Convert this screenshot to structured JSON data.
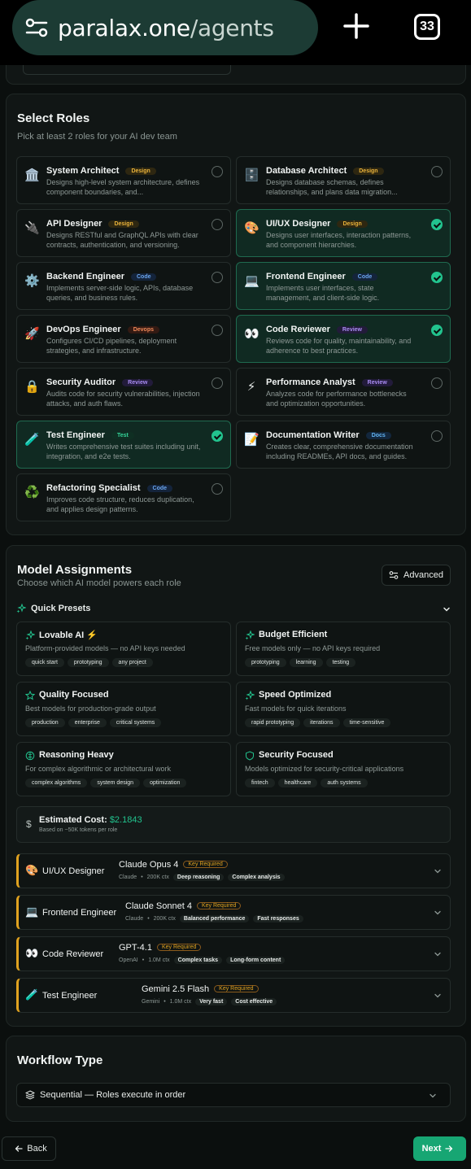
{
  "browser": {
    "url_domain": "paralax.one",
    "url_path": "/agents",
    "tab_count": "33"
  },
  "roles_section": {
    "title": "Select Roles",
    "subtitle": "Pick at least 2 roles for your AI dev team",
    "roles": [
      {
        "emoji": "🏛️",
        "name": "System Architect",
        "tag": "Design",
        "desc": "Designs high-level system architecture, defines component boundaries, and...",
        "selected": false
      },
      {
        "emoji": "🗄️",
        "name": "Database Architect",
        "tag": "Design",
        "desc": "Designs database schemas, defines relationships, and plans data migration...",
        "selected": false
      },
      {
        "emoji": "🔌",
        "name": "API Designer",
        "tag": "Design",
        "desc": "Designs RESTful and GraphQL APIs with clear contracts, authentication, and versioning.",
        "selected": false
      },
      {
        "emoji": "🎨",
        "name": "UI/UX Designer",
        "tag": "Design",
        "desc": "Designs user interfaces, interaction patterns, and component hierarchies.",
        "selected": true
      },
      {
        "emoji": "⚙️",
        "name": "Backend Engineer",
        "tag": "Code",
        "desc": "Implements server-side logic, APIs, database queries, and business rules.",
        "selected": false
      },
      {
        "emoji": "💻",
        "name": "Frontend Engineer",
        "tag": "Code",
        "desc": "Implements user interfaces, state management, and client-side logic.",
        "selected": true
      },
      {
        "emoji": "🚀",
        "name": "DevOps Engineer",
        "tag": "Devops",
        "desc": "Configures CI/CD pipelines, deployment strategies, and infrastructure.",
        "selected": false
      },
      {
        "emoji": "👀",
        "name": "Code Reviewer",
        "tag": "Review",
        "desc": "Reviews code for quality, maintainability, and adherence to best practices.",
        "selected": true
      },
      {
        "emoji": "🔒",
        "name": "Security Auditor",
        "tag": "Review",
        "desc": "Audits code for security vulnerabilities, injection attacks, and auth flaws.",
        "selected": false
      },
      {
        "emoji": "⚡",
        "name": "Performance Analyst",
        "tag": "Review",
        "desc": "Analyzes code for performance bottlenecks and optimization opportunities.",
        "selected": false
      },
      {
        "emoji": "🧪",
        "name": "Test Engineer",
        "tag": "Test",
        "desc": "Writes comprehensive test suites including unit, integration, and e2e tests.",
        "selected": true
      },
      {
        "emoji": "📝",
        "name": "Documentation Writer",
        "tag": "Docs",
        "desc": "Creates clear, comprehensive documentation including READMEs, API docs, and guides.",
        "selected": false
      },
      {
        "emoji": "♻️",
        "name": "Refactoring Specialist",
        "tag": "Code",
        "desc": "Improves code structure, reduces duplication, and applies design patterns.",
        "selected": false
      }
    ]
  },
  "models_section": {
    "title": "Model Assignments",
    "subtitle": "Choose which AI model powers each role",
    "advanced_label": "Advanced",
    "presets_label": "Quick Presets",
    "presets": [
      {
        "icon": "sparkles-icon",
        "name": "Lovable AI ⚡",
        "desc": "Platform-provided models — no API keys needed",
        "chips": [
          "quick start",
          "prototyping",
          "any project"
        ]
      },
      {
        "icon": "sparkles-icon",
        "name": "Budget Efficient",
        "desc": "Free models only — no API keys required",
        "chips": [
          "prototyping",
          "learning",
          "testing"
        ]
      },
      {
        "icon": "star-icon",
        "name": "Quality Focused",
        "desc": "Best models for production-grade output",
        "chips": [
          "production",
          "enterprise",
          "critical systems"
        ]
      },
      {
        "icon": "sparkles-icon",
        "name": "Speed Optimized",
        "desc": "Fast models for quick iterations",
        "chips": [
          "rapid prototyping",
          "iterations",
          "time-sensitive"
        ]
      },
      {
        "icon": "brain-icon",
        "name": "Reasoning Heavy",
        "desc": "For complex algorithmic or architectural work",
        "chips": [
          "complex algorithms",
          "system design",
          "optimization"
        ]
      },
      {
        "icon": "shield-icon",
        "name": "Security Focused",
        "desc": "Models optimized for security-critical applications",
        "chips": [
          "fintech",
          "healthcare",
          "auth systems"
        ]
      }
    ],
    "cost": {
      "label": "Estimated Cost:",
      "value": "$2.1843",
      "note": "Based on ~50K tokens per role"
    },
    "key_required_label": "Key Required",
    "assignments": [
      {
        "emoji": "🎨",
        "role": "UI/UX Designer",
        "model": "Claude Opus 4",
        "provider": "Claude",
        "ctx": "200K ctx",
        "tags": [
          "Deep reasoning",
          "Complex analysis"
        ]
      },
      {
        "emoji": "💻",
        "role": "Frontend Engineer",
        "model": "Claude Sonnet 4",
        "provider": "Claude",
        "ctx": "200K ctx",
        "tags": [
          "Balanced performance",
          "Fast responses"
        ]
      },
      {
        "emoji": "👀",
        "role": "Code Reviewer",
        "model": "GPT-4.1",
        "provider": "OpenAI",
        "ctx": "1.0M ctx",
        "tags": [
          "Complex tasks",
          "Long-form content"
        ]
      },
      {
        "emoji": "🧪",
        "role": "Test Engineer",
        "model": "Gemini 2.5 Flash",
        "provider": "Gemini",
        "ctx": "1.0M ctx",
        "tags": [
          "Very fast",
          "Cost effective"
        ]
      }
    ]
  },
  "workflow_section": {
    "title": "Workflow Type",
    "selected": "Sequential — Roles execute in order"
  },
  "nav": {
    "back_label": "Back",
    "next_label": "Next"
  },
  "colors": {
    "accent": "#22c38e",
    "selected_bg": "#102a22",
    "warning": "#e0a21f"
  }
}
